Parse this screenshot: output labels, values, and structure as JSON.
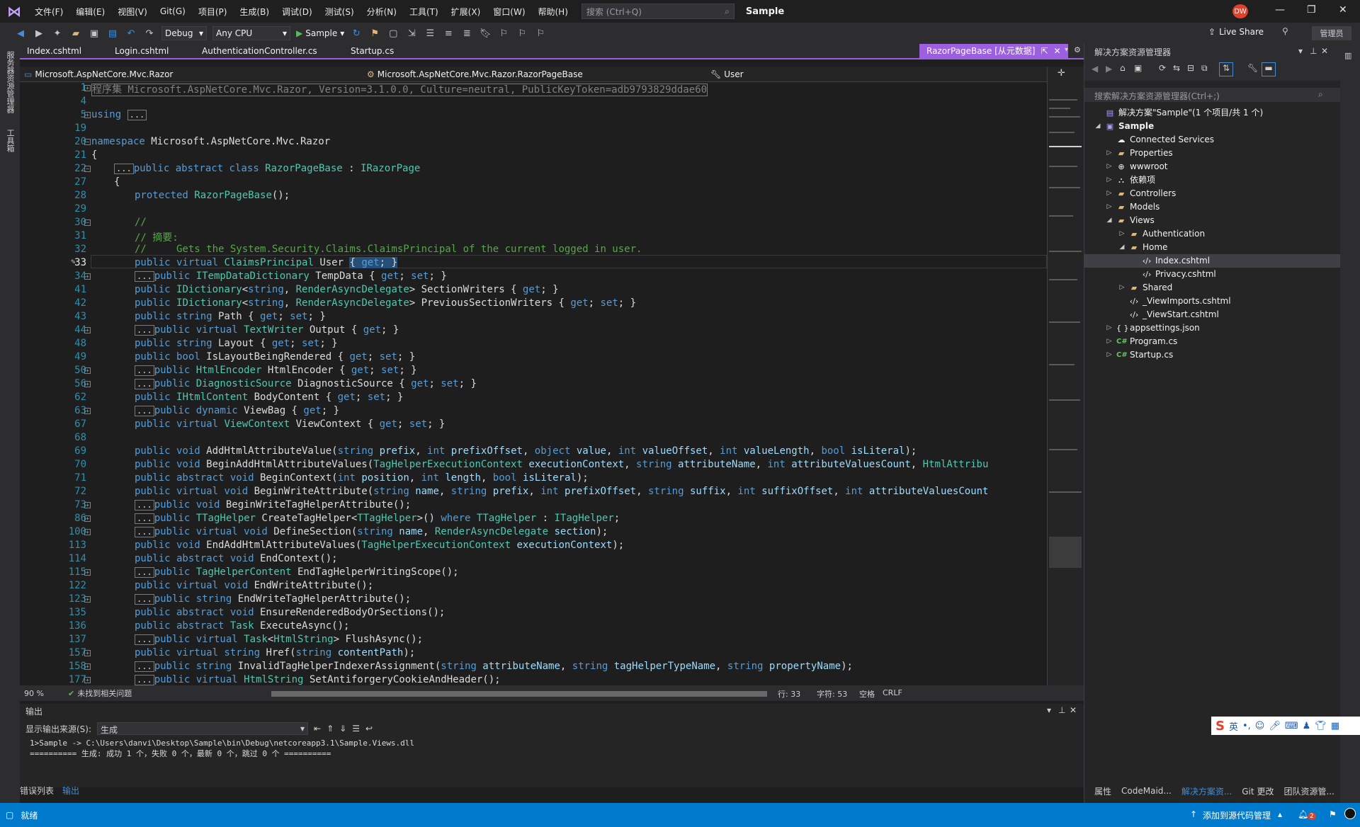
{
  "titlebar": {
    "menus": [
      "文件(F)",
      "编辑(E)",
      "视图(V)",
      "Git(G)",
      "项目(P)",
      "生成(B)",
      "调试(D)",
      "测试(S)",
      "分析(N)",
      "工具(T)",
      "扩展(X)",
      "窗口(W)",
      "帮助(H)"
    ],
    "search_placeholder": "搜索 (Ctrl+Q)",
    "solution_name": "Sample",
    "avatar_initials": "DW"
  },
  "toolbar": {
    "config": "Debug",
    "platform": "Any CPU",
    "run_label": "Sample",
    "live_share": "Live Share",
    "admin": "管理员"
  },
  "left_sidebar": {
    "tab1": "服务器资源管理器",
    "tab2": "工具箱"
  },
  "doc_tabs": {
    "tabs": [
      "Index.cshtml",
      "Login.cshtml",
      "AuthenticationController.cs",
      "Startup.cs"
    ],
    "preview": "RazorPageBase [从元数据]"
  },
  "navbar": {
    "assembly": "Microsoft.AspNetCore.Mvc.Razor",
    "type": "Microsoft.AspNetCore.Mvc.Razor.RazorPageBase",
    "member": "User"
  },
  "editor": {
    "line_numbers": [
      "1",
      "4",
      "5",
      "19",
      "20",
      "21",
      "22",
      "27",
      "28",
      "29",
      "30",
      "31",
      "32",
      "33",
      "34",
      "41",
      "42",
      "43",
      "44",
      "48",
      "49",
      "50",
      "56",
      "62",
      "63",
      "67",
      "68",
      "69",
      "70",
      "71",
      "72",
      "73",
      "86",
      "100",
      "113",
      "114",
      "115",
      "122",
      "123",
      "135",
      "136",
      "137",
      "157",
      "158",
      "177"
    ]
  },
  "editor_status": {
    "zoom": "90 %",
    "issues": "未找到相关问题",
    "line": "行: 33",
    "col": "字符: 53",
    "spaces": "空格",
    "eol": "CRLF"
  },
  "solution_explorer": {
    "title": "解决方案资源管理器",
    "search_placeholder": "搜索解决方案资源管理器(Ctrl+;)",
    "items": [
      {
        "label": "解决方案\"Sample\"(1 个项目/共 1 个)"
      },
      {
        "label": "Sample"
      },
      {
        "label": "Connected Services"
      },
      {
        "label": "Properties"
      },
      {
        "label": "wwwroot"
      },
      {
        "label": "依赖项"
      },
      {
        "label": "Controllers"
      },
      {
        "label": "Models"
      },
      {
        "label": "Views"
      },
      {
        "label": "Authentication"
      },
      {
        "label": "Home"
      },
      {
        "label": "Index.cshtml"
      },
      {
        "label": "Privacy.cshtml"
      },
      {
        "label": "Shared"
      },
      {
        "label": "_ViewImports.cshtml"
      },
      {
        "label": "_ViewStart.cshtml"
      },
      {
        "label": "appsettings.json"
      },
      {
        "label": "Program.cs"
      },
      {
        "label": "Startup.cs"
      }
    ],
    "bottom_tabs": [
      "属性",
      "CodeMaid...",
      "解决方案资...",
      "Git 更改",
      "团队资源管..."
    ]
  },
  "output": {
    "title": "输出",
    "source_label": "显示输出来源(S):",
    "source_value": "生成",
    "line1": "1>Sample -> C:\\Users\\danvi\\Desktop\\Sample\\bin\\Debug\\netcoreapp3.1\\Sample.Views.dll",
    "line2": "========== 生成: 成功 1 个，失败 0 个，最新 0 个，跳过 0 个 ==========",
    "tabs": [
      "错误列表",
      "输出"
    ]
  },
  "statusbar": {
    "ready": "就绪",
    "source_control": "添加到源代码管理",
    "notifications": "2"
  },
  "ime": {
    "mode": "英"
  },
  "colors": {
    "accent": "#9b5fe0",
    "statusbar": "#007acc",
    "keyword": "#569cd6",
    "type": "#4ec9b0",
    "comment": "#57a64a",
    "param": "#9cdcfe"
  }
}
